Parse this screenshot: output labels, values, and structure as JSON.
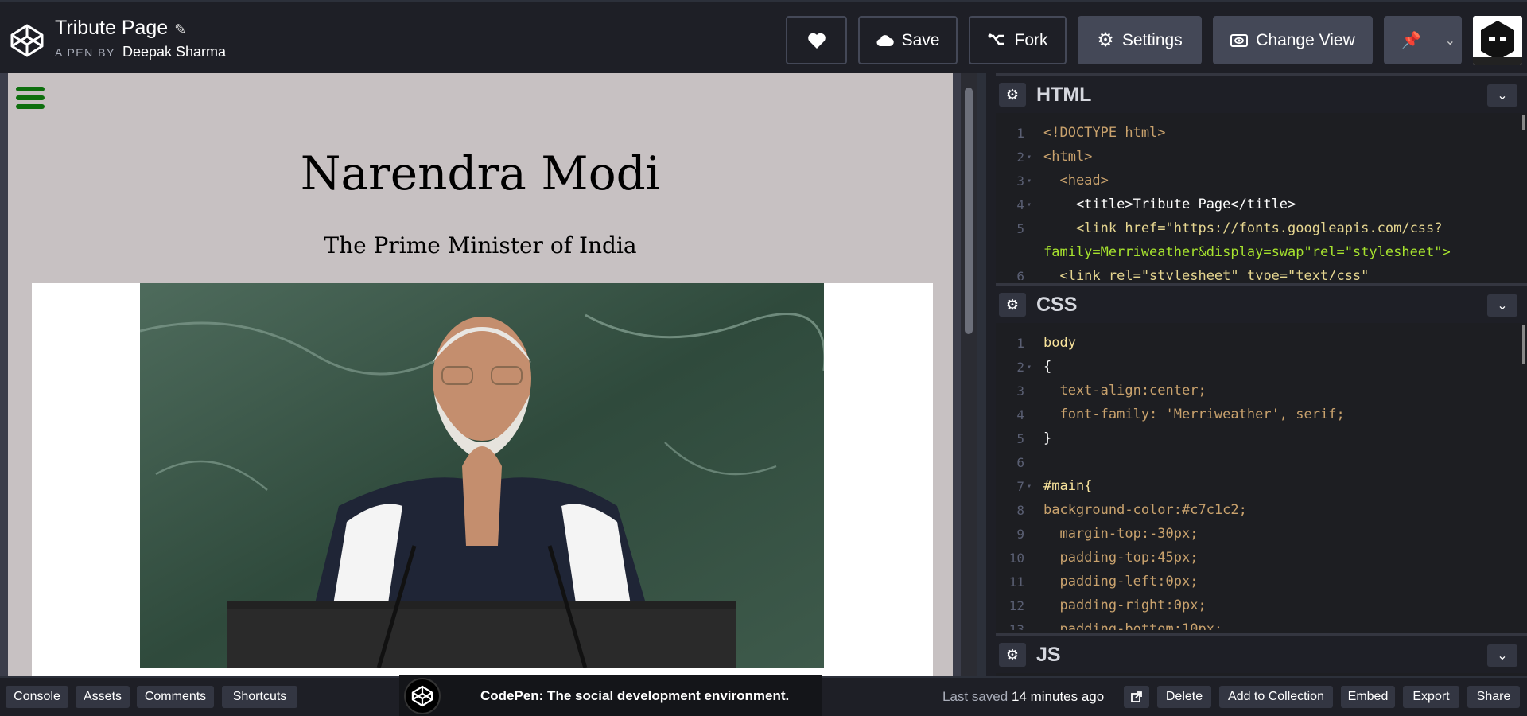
{
  "header": {
    "pen_title": "Tribute Page",
    "pen_by_label": "A PEN BY",
    "author": "Deepak Sharma",
    "buttons": {
      "save": "Save",
      "fork": "Fork",
      "settings": "Settings",
      "change_view": "Change View"
    }
  },
  "preview": {
    "title": "Narendra Modi",
    "subtitle": "The Prime Minister of India"
  },
  "editors": {
    "html": {
      "name": "HTML",
      "lines": [
        {
          "n": "1",
          "fold": false,
          "src": "<!DOCTYPE html>"
        },
        {
          "n": "2",
          "fold": true,
          "src": "<html>"
        },
        {
          "n": "3",
          "fold": true,
          "src": "  <head>"
        },
        {
          "n": "4",
          "fold": true,
          "src": "    <title>Tribute Page</title>"
        },
        {
          "n": "5",
          "fold": false,
          "src": "    <link href=\"https://fonts.googleapis.com/css?"
        },
        {
          "n": "",
          "fold": false,
          "src": "family=Merriweather&display=swap\"rel=\"stylesheet\">"
        },
        {
          "n": "6",
          "fold": false,
          "src": "  <link rel=\"stylesheet\" type=\"text/css\""
        }
      ]
    },
    "css": {
      "name": "CSS",
      "lines": [
        {
          "n": "1",
          "fold": false,
          "src": "body"
        },
        {
          "n": "2",
          "fold": true,
          "src": "{"
        },
        {
          "n": "3",
          "fold": false,
          "src": "  text-align:center;"
        },
        {
          "n": "4",
          "fold": false,
          "src": "  font-family: 'Merriweather', serif;"
        },
        {
          "n": "5",
          "fold": false,
          "src": "}"
        },
        {
          "n": "6",
          "fold": false,
          "src": ""
        },
        {
          "n": "7",
          "fold": true,
          "src": "#main{"
        },
        {
          "n": "8",
          "fold": false,
          "src": "background-color:#c7c1c2;"
        },
        {
          "n": "9",
          "fold": false,
          "src": "  margin-top:-30px;"
        },
        {
          "n": "10",
          "fold": false,
          "src": "  padding-top:45px;"
        },
        {
          "n": "11",
          "fold": false,
          "src": "  padding-left:0px;"
        },
        {
          "n": "12",
          "fold": false,
          "src": "  padding-right:0px;"
        },
        {
          "n": "13",
          "fold": false,
          "src": "  padding-bottom:10px;"
        }
      ]
    },
    "js": {
      "name": "JS"
    }
  },
  "footer": {
    "console": "Console",
    "assets": "Assets",
    "comments": "Comments",
    "shortcuts": "Shortcuts",
    "toast": "CodePen: The social development environment.",
    "last_saved_label": "Last saved",
    "last_saved_value": "14 minutes ago",
    "delete": "Delete",
    "add_to_collection": "Add to Collection",
    "embed": "Embed",
    "export": "Export",
    "share": "Share"
  }
}
